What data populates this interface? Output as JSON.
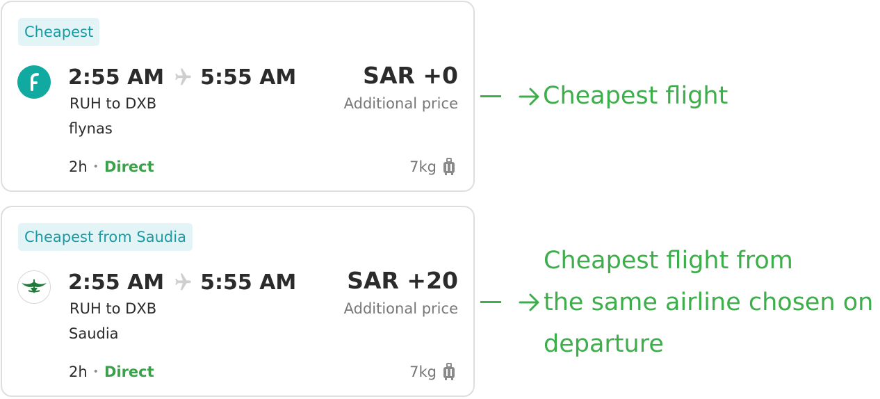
{
  "cards": [
    {
      "badge": "Cheapest",
      "logo": "flynas-logo",
      "depart": "2:55 AM",
      "arrive": "5:55 AM",
      "route": "RUH to DXB",
      "airline": "flynas",
      "duration": "2h",
      "stops": "Direct",
      "price": "SAR +0",
      "price_note": "Additional price",
      "baggage": "7kg"
    },
    {
      "badge": "Cheapest from Saudia",
      "logo": "saudia-logo",
      "depart": "2:55 AM",
      "arrive": "5:55 AM",
      "route": "RUH to DXB",
      "airline": "Saudia",
      "duration": "2h",
      "stops": "Direct",
      "price": "SAR +20",
      "price_note": "Additional price",
      "baggage": "7kg"
    }
  ],
  "annotations": {
    "first": "Cheapest flight",
    "second_lines": [
      "Cheapest flight from",
      "the same airline chosen on",
      "departure"
    ]
  },
  "colors": {
    "badge_bg": "#e3f4f6",
    "badge_text": "#1a9aa5",
    "direct": "#3aa14a",
    "annotation": "#3cae4a",
    "flynas": "#10aaa0",
    "saudia": "#1f7a3a"
  },
  "icons": [
    "plane-icon",
    "luggage-icon",
    "arrow-right-icon",
    "flynas-logo",
    "saudia-logo"
  ]
}
